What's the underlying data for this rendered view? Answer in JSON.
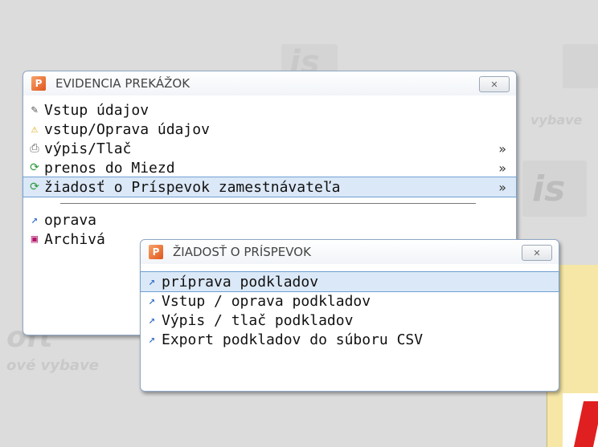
{
  "main_menu": {
    "title": "EVIDENCIA PREKÁŽOK",
    "close_label": "✕",
    "items": [
      {
        "label": "Vstup údajov",
        "icon": "edit-icon",
        "arrow": ""
      },
      {
        "label": "vstup/Oprava údajov",
        "icon": "warning-edit-icon",
        "arrow": ""
      },
      {
        "label": "výpis/Tlač",
        "icon": "print-icon",
        "arrow": "»"
      },
      {
        "label": "prenos do Miezd",
        "icon": "transfer-icon",
        "arrow": "»"
      },
      {
        "label": "žiadosť o Príspevok zamestnávateľa",
        "icon": "transfer-icon",
        "arrow": "»"
      },
      {
        "label": "oprava",
        "icon": "chart-icon",
        "arrow": ""
      },
      {
        "label": "Archivá",
        "icon": "archive-icon",
        "arrow": ""
      }
    ]
  },
  "sub_menu": {
    "title": "ŽIADOSŤ O PRÍSPEVOK",
    "close_label": "✕",
    "items": [
      {
        "label": "príprava podkladov"
      },
      {
        "label": "Vstup / oprava podkladov"
      },
      {
        "label": "Výpis / tlač podkladov"
      },
      {
        "label": "Export podkladov do súboru CSV"
      }
    ]
  },
  "watermark_text": [
    "is",
    "oft",
    "ové vybave",
    "vybave"
  ]
}
